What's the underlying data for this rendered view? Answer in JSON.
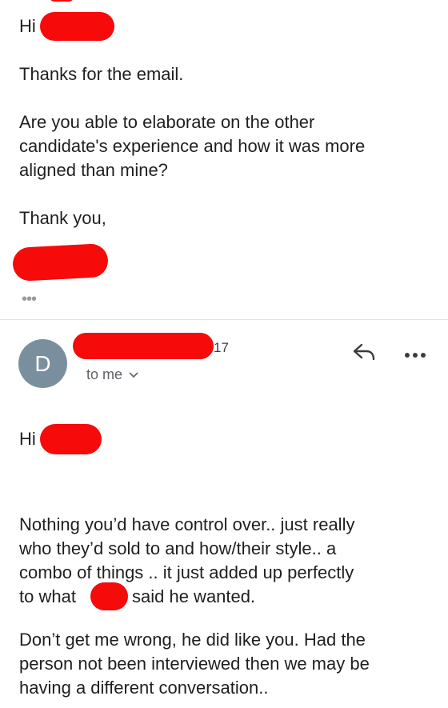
{
  "first_message": {
    "greeting": "Hi",
    "paragraphs": [
      "Thanks for the email.",
      "Are you able to elaborate on the other",
      "candidate's experience and how it was more",
      "aligned than mine?",
      "Thank you,"
    ],
    "expand_label": "•••"
  },
  "second_message": {
    "avatar_letter": "D",
    "date_fragment": "17",
    "recipient_label": "to me",
    "greeting": "Hi",
    "para1_line1": "Nothing you’d have control over.. just really",
    "para1_line2": "who they’d sold to and how/their style.. a",
    "para1_line3": "combo of things .. it just added up perfectly",
    "para1_line4a": "to what",
    "para1_line4b": "said he wanted.",
    "para2_line1": "Don’t get me wrong, he did like you.  Had the",
    "para2_line2": "person not been interviewed then we may be",
    "para2_line3": "having a different conversation.."
  },
  "icons": {
    "reply": "reply-icon",
    "more": "more-options-icon",
    "chevron": "chevron-down-icon"
  },
  "colors": {
    "redaction": "#f70a0a",
    "avatar_bg": "#7a8f9e"
  }
}
